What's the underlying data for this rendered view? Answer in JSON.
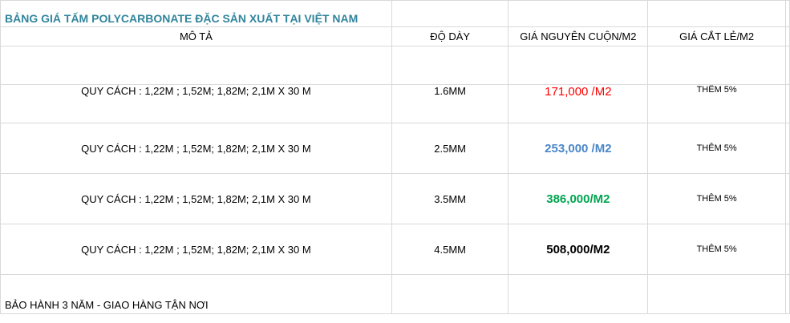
{
  "title": "BẢNG GIÁ TẤM POLYCARBONATE ĐẶC SẢN XUẤT TẠI VIỆT NAM",
  "headers": {
    "description": "MÔ TẢ",
    "thickness": "ĐỘ DÀY",
    "roll_price": "GIÁ NGUYÊN CUỘN/M2",
    "cut_price": "GIÁ CẮT LẺ/M2"
  },
  "rows": [
    {
      "description": "QUY CÁCH : 1,22M ; 1,52M; 1,82M; 2,1M  X 30 M",
      "thickness": "1.6MM",
      "price": "171,000 /M2",
      "cut": "THÊM 5%"
    },
    {
      "description": "QUY CÁCH : 1,22M ; 1,52M; 1,82M; 2,1M  X 30 M",
      "thickness": "2.5MM",
      "price": "253,000 /M2",
      "cut": "THÊM 5%"
    },
    {
      "description": "QUY CÁCH : 1,22M ; 1,52M; 1,82M; 2,1M  X 30 M",
      "thickness": "3.5MM",
      "price": "386,000/M2",
      "cut": "THÊM 5%"
    },
    {
      "description": "QUY CÁCH : 1,22M ; 1,52M; 1,82M; 2,1M  X 30 M",
      "thickness": "4.5MM",
      "price": "508,000/M2",
      "cut": "THÊM 5%"
    }
  ],
  "price_colors": [
    "#ff0000",
    "#4a86c8",
    "#00a550",
    "#000000"
  ],
  "footer": "BẢO HÀNH 3 NĂM - GIAO HÀNG TẬN NƠI"
}
